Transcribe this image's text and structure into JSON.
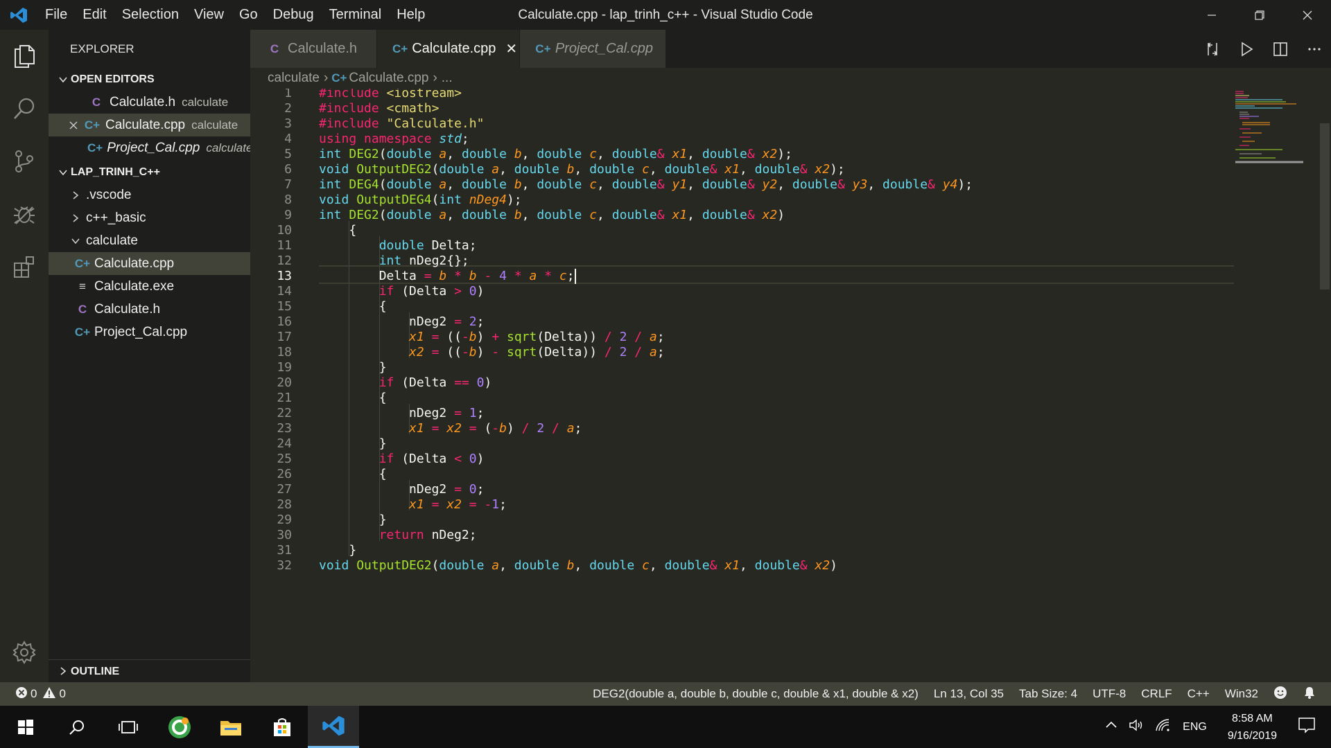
{
  "window": {
    "title": "Calculate.cpp - lap_trinh_c++ - Visual Studio Code",
    "menu": [
      "File",
      "Edit",
      "Selection",
      "View",
      "Go",
      "Debug",
      "Terminal",
      "Help"
    ]
  },
  "sidebar": {
    "title": "EXPLORER",
    "open_editors": {
      "label": "OPEN EDITORS",
      "items": [
        {
          "icon": "C",
          "name": "Calculate.h",
          "desc": "calculate"
        },
        {
          "icon": "C+",
          "name": "Calculate.cpp",
          "desc": "calculate"
        },
        {
          "icon": "C+",
          "name": "Project_Cal.cpp",
          "desc": "calculate"
        }
      ]
    },
    "workspace": {
      "label": "LAP_TRINH_C++",
      "items": [
        ".vscode",
        "c++_basic",
        "calculate",
        "Calculate.cpp",
        "Calculate.exe",
        "Calculate.h",
        "Project_Cal.cpp"
      ]
    },
    "outline_label": "OUTLINE"
  },
  "tabs": [
    {
      "label": "Calculate.h",
      "icon": "C"
    },
    {
      "label": "Calculate.cpp",
      "icon": "C+",
      "active": true
    },
    {
      "label": "Project_Cal.cpp",
      "icon": "C+"
    }
  ],
  "breadcrumb": [
    "calculate",
    "Calculate.cpp",
    "..."
  ],
  "editor": {
    "current_line": 13,
    "lines": [
      [
        [
          "kw",
          "#include "
        ],
        [
          "str",
          "<iostream>"
        ]
      ],
      [
        [
          "kw",
          "#include "
        ],
        [
          "str",
          "<cmath>"
        ]
      ],
      [
        [
          "kw",
          "#include "
        ],
        [
          "str",
          "\"Calculate.h\""
        ]
      ],
      [
        [
          "kw",
          "using "
        ],
        [
          "kw",
          "namespace "
        ],
        [
          "ty2",
          "std"
        ],
        [
          "txt",
          ";"
        ]
      ],
      [
        [
          "ty",
          "int "
        ],
        [
          "fn",
          "DEG2"
        ],
        [
          "txt",
          "("
        ],
        [
          "ty",
          "double "
        ],
        [
          "pa",
          "a"
        ],
        [
          "txt",
          ", "
        ],
        [
          "ty",
          "double "
        ],
        [
          "pa",
          "b"
        ],
        [
          "txt",
          ", "
        ],
        [
          "ty",
          "double "
        ],
        [
          "pa",
          "c"
        ],
        [
          "txt",
          ", "
        ],
        [
          "ty",
          "double"
        ],
        [
          "op",
          "& "
        ],
        [
          "pa",
          "x1"
        ],
        [
          "txt",
          ", "
        ],
        [
          "ty",
          "double"
        ],
        [
          "op",
          "& "
        ],
        [
          "pa",
          "x2"
        ],
        [
          "txt",
          ");"
        ]
      ],
      [
        [
          "ty",
          "void "
        ],
        [
          "fn",
          "OutputDEG2"
        ],
        [
          "txt",
          "("
        ],
        [
          "ty",
          "double "
        ],
        [
          "pa",
          "a"
        ],
        [
          "txt",
          ", "
        ],
        [
          "ty",
          "double "
        ],
        [
          "pa",
          "b"
        ],
        [
          "txt",
          ", "
        ],
        [
          "ty",
          "double "
        ],
        [
          "pa",
          "c"
        ],
        [
          "txt",
          ", "
        ],
        [
          "ty",
          "double"
        ],
        [
          "op",
          "& "
        ],
        [
          "pa",
          "x1"
        ],
        [
          "txt",
          ", "
        ],
        [
          "ty",
          "double"
        ],
        [
          "op",
          "& "
        ],
        [
          "pa",
          "x2"
        ],
        [
          "txt",
          ");"
        ]
      ],
      [
        [
          "ty",
          "int "
        ],
        [
          "fn",
          "DEG4"
        ],
        [
          "txt",
          "("
        ],
        [
          "ty",
          "double "
        ],
        [
          "pa",
          "a"
        ],
        [
          "txt",
          ", "
        ],
        [
          "ty",
          "double "
        ],
        [
          "pa",
          "b"
        ],
        [
          "txt",
          ", "
        ],
        [
          "ty",
          "double "
        ],
        [
          "pa",
          "c"
        ],
        [
          "txt",
          ", "
        ],
        [
          "ty",
          "double"
        ],
        [
          "op",
          "& "
        ],
        [
          "pa",
          "y1"
        ],
        [
          "txt",
          ", "
        ],
        [
          "ty",
          "double"
        ],
        [
          "op",
          "& "
        ],
        [
          "pa",
          "y2"
        ],
        [
          "txt",
          ", "
        ],
        [
          "ty",
          "double"
        ],
        [
          "op",
          "& "
        ],
        [
          "pa",
          "y3"
        ],
        [
          "txt",
          ", "
        ],
        [
          "ty",
          "double"
        ],
        [
          "op",
          "& "
        ],
        [
          "pa",
          "y4"
        ],
        [
          "txt",
          ");"
        ]
      ],
      [
        [
          "ty",
          "void "
        ],
        [
          "fn",
          "OutputDEG4"
        ],
        [
          "txt",
          "("
        ],
        [
          "ty",
          "int "
        ],
        [
          "pa",
          "nDeg4"
        ],
        [
          "txt",
          ");"
        ]
      ],
      [
        [
          "ty",
          "int "
        ],
        [
          "fn",
          "DEG2"
        ],
        [
          "txt",
          "("
        ],
        [
          "ty",
          "double "
        ],
        [
          "pa",
          "a"
        ],
        [
          "txt",
          ", "
        ],
        [
          "ty",
          "double "
        ],
        [
          "pa",
          "b"
        ],
        [
          "txt",
          ", "
        ],
        [
          "ty",
          "double "
        ],
        [
          "pa",
          "c"
        ],
        [
          "txt",
          ", "
        ],
        [
          "ty",
          "double"
        ],
        [
          "op",
          "& "
        ],
        [
          "pa",
          "x1"
        ],
        [
          "txt",
          ", "
        ],
        [
          "ty",
          "double"
        ],
        [
          "op",
          "& "
        ],
        [
          "pa",
          "x2"
        ],
        [
          "txt",
          ")"
        ]
      ],
      [
        [
          "txt",
          "    {"
        ]
      ],
      [
        [
          "txt",
          "        "
        ],
        [
          "ty",
          "double "
        ],
        [
          "txt",
          "Delta;"
        ]
      ],
      [
        [
          "txt",
          "        "
        ],
        [
          "ty",
          "int "
        ],
        [
          "txt",
          "nDeg2{};"
        ]
      ],
      [
        [
          "txt",
          "        Delta "
        ],
        [
          "op",
          "= "
        ],
        [
          "pa",
          "b "
        ],
        [
          "op",
          "* "
        ],
        [
          "pa",
          "b "
        ],
        [
          "op",
          "- "
        ],
        [
          "num",
          "4 "
        ],
        [
          "op",
          "* "
        ],
        [
          "pa",
          "a "
        ],
        [
          "op",
          "* "
        ],
        [
          "pa",
          "c"
        ],
        [
          "txt",
          ";"
        ]
      ],
      [
        [
          "txt",
          "        "
        ],
        [
          "kw",
          "if "
        ],
        [
          "txt",
          "(Delta "
        ],
        [
          "op",
          "> "
        ],
        [
          "num",
          "0"
        ],
        [
          "txt",
          ")"
        ]
      ],
      [
        [
          "txt",
          "        {"
        ]
      ],
      [
        [
          "txt",
          "            nDeg2 "
        ],
        [
          "op",
          "= "
        ],
        [
          "num",
          "2"
        ],
        [
          "txt",
          ";"
        ]
      ],
      [
        [
          "txt",
          "            "
        ],
        [
          "pa",
          "x1 "
        ],
        [
          "op",
          "= "
        ],
        [
          "txt",
          "(("
        ],
        [
          "op",
          "-"
        ],
        [
          "pa",
          "b"
        ],
        [
          "txt",
          ") "
        ],
        [
          "op",
          "+ "
        ],
        [
          "fn",
          "sqrt"
        ],
        [
          "txt",
          "(Delta)) "
        ],
        [
          "op",
          "/ "
        ],
        [
          "num",
          "2 "
        ],
        [
          "op",
          "/ "
        ],
        [
          "pa",
          "a"
        ],
        [
          "txt",
          ";"
        ]
      ],
      [
        [
          "txt",
          "            "
        ],
        [
          "pa",
          "x2 "
        ],
        [
          "op",
          "= "
        ],
        [
          "txt",
          "(("
        ],
        [
          "op",
          "-"
        ],
        [
          "pa",
          "b"
        ],
        [
          "txt",
          ") "
        ],
        [
          "op",
          "- "
        ],
        [
          "fn",
          "sqrt"
        ],
        [
          "txt",
          "(Delta)) "
        ],
        [
          "op",
          "/ "
        ],
        [
          "num",
          "2 "
        ],
        [
          "op",
          "/ "
        ],
        [
          "pa",
          "a"
        ],
        [
          "txt",
          ";"
        ]
      ],
      [
        [
          "txt",
          "        }"
        ]
      ],
      [
        [
          "txt",
          "        "
        ],
        [
          "kw",
          "if "
        ],
        [
          "txt",
          "(Delta "
        ],
        [
          "op",
          "== "
        ],
        [
          "num",
          "0"
        ],
        [
          "txt",
          ")"
        ]
      ],
      [
        [
          "txt",
          "        {"
        ]
      ],
      [
        [
          "txt",
          "            nDeg2 "
        ],
        [
          "op",
          "= "
        ],
        [
          "num",
          "1"
        ],
        [
          "txt",
          ";"
        ]
      ],
      [
        [
          "txt",
          "            "
        ],
        [
          "pa",
          "x1 "
        ],
        [
          "op",
          "= "
        ],
        [
          "pa",
          "x2 "
        ],
        [
          "op",
          "= "
        ],
        [
          "txt",
          "("
        ],
        [
          "op",
          "-"
        ],
        [
          "pa",
          "b"
        ],
        [
          "txt",
          ") "
        ],
        [
          "op",
          "/ "
        ],
        [
          "num",
          "2 "
        ],
        [
          "op",
          "/ "
        ],
        [
          "pa",
          "a"
        ],
        [
          "txt",
          ";"
        ]
      ],
      [
        [
          "txt",
          "        }"
        ]
      ],
      [
        [
          "txt",
          "        "
        ],
        [
          "kw",
          "if "
        ],
        [
          "txt",
          "(Delta "
        ],
        [
          "op",
          "< "
        ],
        [
          "num",
          "0"
        ],
        [
          "txt",
          ")"
        ]
      ],
      [
        [
          "txt",
          "        {"
        ]
      ],
      [
        [
          "txt",
          "            nDeg2 "
        ],
        [
          "op",
          "= "
        ],
        [
          "num",
          "0"
        ],
        [
          "txt",
          ";"
        ]
      ],
      [
        [
          "txt",
          "            "
        ],
        [
          "pa",
          "x1 "
        ],
        [
          "op",
          "= "
        ],
        [
          "pa",
          "x2 "
        ],
        [
          "op",
          "= "
        ],
        [
          "op",
          "-"
        ],
        [
          "num",
          "1"
        ],
        [
          "txt",
          ";"
        ]
      ],
      [
        [
          "txt",
          "        }"
        ]
      ],
      [
        [
          "txt",
          "        "
        ],
        [
          "kw",
          "return "
        ],
        [
          "txt",
          "nDeg2;"
        ]
      ],
      [
        [
          "txt",
          "    }"
        ]
      ],
      [
        [
          "ty",
          "void "
        ],
        [
          "fn",
          "OutputDEG2"
        ],
        [
          "txt",
          "("
        ],
        [
          "ty",
          "double "
        ],
        [
          "pa",
          "a"
        ],
        [
          "txt",
          ", "
        ],
        [
          "ty",
          "double "
        ],
        [
          "pa",
          "b"
        ],
        [
          "txt",
          ", "
        ],
        [
          "ty",
          "double "
        ],
        [
          "pa",
          "c"
        ],
        [
          "txt",
          ", "
        ],
        [
          "ty",
          "double"
        ],
        [
          "op",
          "& "
        ],
        [
          "pa",
          "x1"
        ],
        [
          "txt",
          ", "
        ],
        [
          "ty",
          "double"
        ],
        [
          "op",
          "& "
        ],
        [
          "pa",
          "x2"
        ],
        [
          "txt",
          ")"
        ]
      ]
    ]
  },
  "statusbar": {
    "errors": "0",
    "warnings": "0",
    "signature": "DEG2(double a, double b, double c, double & x1, double & x2)",
    "position": "Ln 13, Col 35",
    "tab_size": "Tab Size: 4",
    "encoding": "UTF-8",
    "eol": "CRLF",
    "language": "C++",
    "platform": "Win32"
  },
  "taskbar": {
    "lang": "ENG",
    "time": "8:58 AM",
    "date": "9/16/2019"
  },
  "colors": {
    "accent": "#76b9ed",
    "keyword": "#f92672",
    "type": "#66d9ef",
    "function": "#a6e22e",
    "param": "#fd971f",
    "string": "#e6db74",
    "number": "#ae81ff"
  }
}
